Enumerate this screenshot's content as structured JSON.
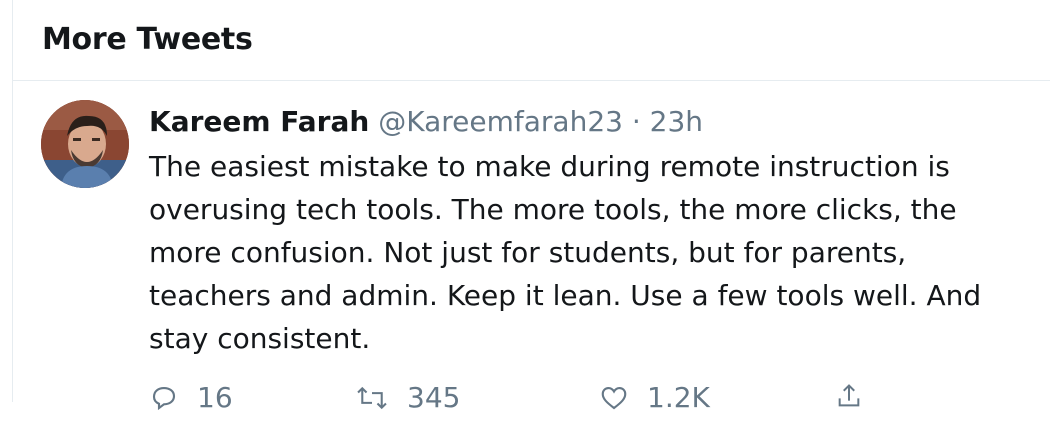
{
  "header": {
    "title": "More Tweets"
  },
  "tweet": {
    "author_name": "Kareem Farah",
    "author_handle": "@Kareemfarah23",
    "separator": "·",
    "time": "23h",
    "text": "The easiest mistake to make during remote instruction is overusing tech tools. The more tools, the more clicks, the more confusion. Not just for students, but for parents, teachers and admin. Keep it lean. Use a few tools well. And stay consistent.",
    "actions": {
      "reply_count": "16",
      "retweet_count": "345",
      "like_count": "1.2K"
    }
  },
  "icons": {
    "reply": "reply-icon",
    "retweet": "retweet-icon",
    "like": "heart-icon",
    "share": "share-icon"
  },
  "colors": {
    "text_primary": "#14171a",
    "text_secondary": "#657786",
    "border": "#e6ecf0"
  }
}
